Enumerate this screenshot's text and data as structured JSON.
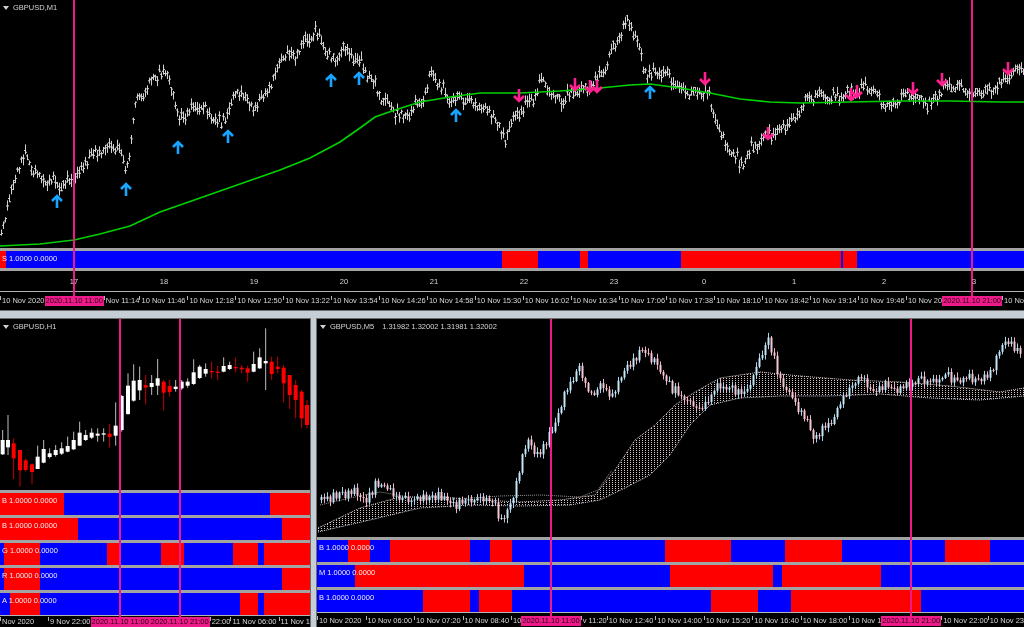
{
  "windows": [
    {
      "kind": "bars",
      "title": "GBPUSD,M1",
      "indicators": [
        {
          "label": "S 1.0000 0.0000",
          "segments": [
            {
              "color": "#ff0000"
            },
            {
              "color": "#0000ff"
            },
            {
              "color": "#ff0000"
            },
            {
              "color": "#0000ff"
            },
            {
              "color": "#ff0000"
            },
            {
              "color": "#0000ff"
            },
            {
              "color": "#ff0000"
            },
            {
              "color": "#0000ff"
            },
            {
              "color": "#ff0000"
            },
            {
              "color": "#0000ff"
            }
          ]
        }
      ],
      "hour_labels": [
        "17",
        "18",
        "19",
        "20",
        "21",
        "22",
        "23",
        "0",
        "1",
        "2",
        "3"
      ],
      "time_axis": [
        {
          "kind": "date",
          "text": "10 Nov 2020"
        },
        {
          "kind": "marker",
          "text": "2020.11.10 11:00"
        },
        {
          "kind": "date",
          "text": "Nov 11:14"
        },
        {
          "kind": "date",
          "text": "10 Nov 11:46"
        },
        {
          "kind": "date",
          "text": "10 Nov 12:18"
        },
        {
          "kind": "date",
          "text": "10 Nov 12:50"
        },
        {
          "kind": "date",
          "text": "10 Nov 13:22"
        },
        {
          "kind": "date",
          "text": "10 Nov 13:54"
        },
        {
          "kind": "date",
          "text": "10 Nov 14:26"
        },
        {
          "kind": "date",
          "text": "10 Nov 14:58"
        },
        {
          "kind": "date",
          "text": "10 Nov 15:30"
        },
        {
          "kind": "date",
          "text": "10 Nov 16:02"
        },
        {
          "kind": "date",
          "text": "10 Nov 16:34"
        },
        {
          "kind": "date",
          "text": "10 Nov 17:06"
        },
        {
          "kind": "date",
          "text": "10 Nov 17:38"
        },
        {
          "kind": "date",
          "text": "10 Nov 18:10"
        },
        {
          "kind": "date",
          "text": "10 Nov 18:42"
        },
        {
          "kind": "date",
          "text": "10 Nov 19:14"
        },
        {
          "kind": "date",
          "text": "10 Nov 19:46"
        },
        {
          "kind": "date",
          "text": "10 Nov 20"
        },
        {
          "kind": "marker",
          "text": "2020.11.10 21:00"
        },
        {
          "kind": "date",
          "text": "10 No"
        }
      ]
    },
    {
      "kind": "candles",
      "title": "GBPUSD,H1",
      "indicators": [
        {
          "label": "B 1.0000 0.0000",
          "segments": [
            {
              "color": "#ff0000"
            },
            {
              "color": "#0000ff"
            },
            {
              "color": "#ff0000"
            }
          ]
        },
        {
          "label": "B 1.0000 0.0000",
          "segments": [
            {
              "color": "#ff0000"
            },
            {
              "color": "#0000ff"
            },
            {
              "color": "#ff0000"
            }
          ]
        },
        {
          "label": "G 1.0000 0.0000",
          "segments": [
            {
              "color": "#0000ff"
            },
            {
              "color": "#ff0000"
            },
            {
              "color": "#0000ff"
            },
            {
              "color": "#ff0000"
            },
            {
              "color": "#0000ff"
            },
            {
              "color": "#ff0000"
            },
            {
              "color": "#0000ff"
            },
            {
              "color": "#ff0000"
            },
            {
              "color": "#0000ff"
            },
            {
              "color": "#ff0000"
            }
          ]
        },
        {
          "label": "R 1.0000 0.0000",
          "segments": [
            {
              "color": "#0000ff"
            },
            {
              "color": "#ff0000"
            },
            {
              "color": "#0000ff"
            },
            {
              "color": "#ff0000"
            }
          ]
        },
        {
          "label": "A 1.0000 0.0000",
          "segments": [
            {
              "color": "#0000ff"
            },
            {
              "color": "#ff0000"
            },
            {
              "color": "#0000ff"
            },
            {
              "color": "#ff0000"
            },
            {
              "color": "#0000ff"
            },
            {
              "color": "#ff0000"
            }
          ]
        }
      ],
      "time_axis": [
        {
          "kind": "date",
          "text": "Nov 2020"
        },
        {
          "kind": "date",
          "text": "9 Nov 22:00"
        },
        {
          "kind": "marker",
          "text": "2020.11.10 11:00"
        },
        {
          "kind": "marker",
          "text": "2020.11.10 21:00"
        },
        {
          "kind": "date",
          "text": "22:00"
        },
        {
          "kind": "date",
          "text": "11 Nov 06:00"
        },
        {
          "kind": "date",
          "text": "11 Nov 1"
        }
      ]
    },
    {
      "kind": "cloud",
      "title": "GBPUSD,M5",
      "quote": "1.31982 1.32002 1.31981 1.32002",
      "indicators": [
        {
          "label": "B 1.0000 0.0000",
          "segments": [
            {
              "color": "#0000ff"
            },
            {
              "color": "#ff0000"
            },
            {
              "color": "#0000ff"
            },
            {
              "color": "#ff0000"
            },
            {
              "color": "#0000ff"
            },
            {
              "color": "#ff0000"
            },
            {
              "color": "#0000ff"
            },
            {
              "color": "#ff0000"
            },
            {
              "color": "#0000ff"
            },
            {
              "color": "#ff0000"
            },
            {
              "color": "#0000ff"
            },
            {
              "color": "#ff0000"
            },
            {
              "color": "#0000ff"
            }
          ]
        },
        {
          "label": "M 1.0000 0.0000",
          "segments": [
            {
              "color": "#0000ff"
            },
            {
              "color": "#ff0000"
            },
            {
              "color": "#0000ff"
            },
            {
              "color": "#ff0000"
            },
            {
              "color": "#0000ff"
            },
            {
              "color": "#ff0000"
            },
            {
              "color": "#0000ff"
            }
          ]
        },
        {
          "label": "B 1.0000 0.0000",
          "segments": [
            {
              "color": "#0000ff"
            },
            {
              "color": "#ff0000"
            },
            {
              "color": "#0000ff"
            },
            {
              "color": "#ff0000"
            },
            {
              "color": "#0000ff"
            },
            {
              "color": "#ff0000"
            },
            {
              "color": "#0000ff"
            },
            {
              "color": "#ff0000"
            },
            {
              "color": "#0000ff"
            }
          ]
        }
      ],
      "time_axis": [
        {
          "kind": "date",
          "text": "10 Nov 2020"
        },
        {
          "kind": "date",
          "text": "10 Nov 06:00"
        },
        {
          "kind": "date",
          "text": "10 Nov 07:20"
        },
        {
          "kind": "date",
          "text": "10 Nov 08:40"
        },
        {
          "kind": "date",
          "text": "10"
        },
        {
          "kind": "marker",
          "text": "2020.11.10 11:00"
        },
        {
          "kind": "date",
          "text": "v 11:20"
        },
        {
          "kind": "date",
          "text": "10 Nov 12:40"
        },
        {
          "kind": "date",
          "text": "10 Nov 14:00"
        },
        {
          "kind": "date",
          "text": "10 Nov 15:20"
        },
        {
          "kind": "date",
          "text": "10 Nov 16:40"
        },
        {
          "kind": "date",
          "text": "10 Nov 18:00"
        },
        {
          "kind": "date",
          "text": "10 Nov 1"
        },
        {
          "kind": "marker",
          "text": "2020.11.10 21:00"
        },
        {
          "kind": "date",
          "text": "10 Nov 22:00"
        },
        {
          "kind": "date",
          "text": "10 Nov 23"
        }
      ]
    }
  ]
}
